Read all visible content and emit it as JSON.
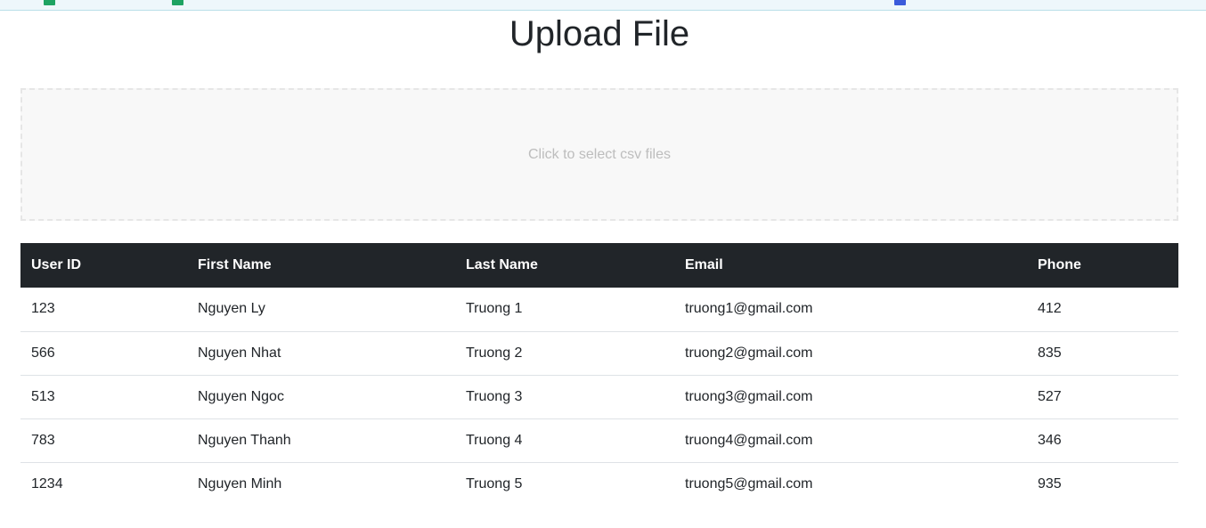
{
  "page": {
    "title": "Upload File"
  },
  "dropzone": {
    "text": "Click to select csv files"
  },
  "table": {
    "headers": [
      "User ID",
      "First Name",
      "Last Name",
      "Email",
      "Phone"
    ],
    "rows": [
      [
        "123",
        "Nguyen Ly",
        "Truong 1",
        "truong1@gmail.com",
        "412"
      ],
      [
        "566",
        "Nguyen Nhat",
        "Truong 2",
        "truong2@gmail.com",
        "835"
      ],
      [
        "513",
        "Nguyen Ngoc",
        "Truong 3",
        "truong3@gmail.com",
        "527"
      ],
      [
        "783",
        "Nguyen Thanh",
        "Truong 4",
        "truong4@gmail.com",
        "346"
      ],
      [
        "1234",
        "Nguyen Minh",
        "Truong 5",
        "truong5@gmail.com",
        "935"
      ]
    ]
  },
  "colors": {
    "header_bg": "#212529",
    "dropzone_bg": "#f8f8f8",
    "bookmark_bar_bg": "#eef7fb"
  }
}
